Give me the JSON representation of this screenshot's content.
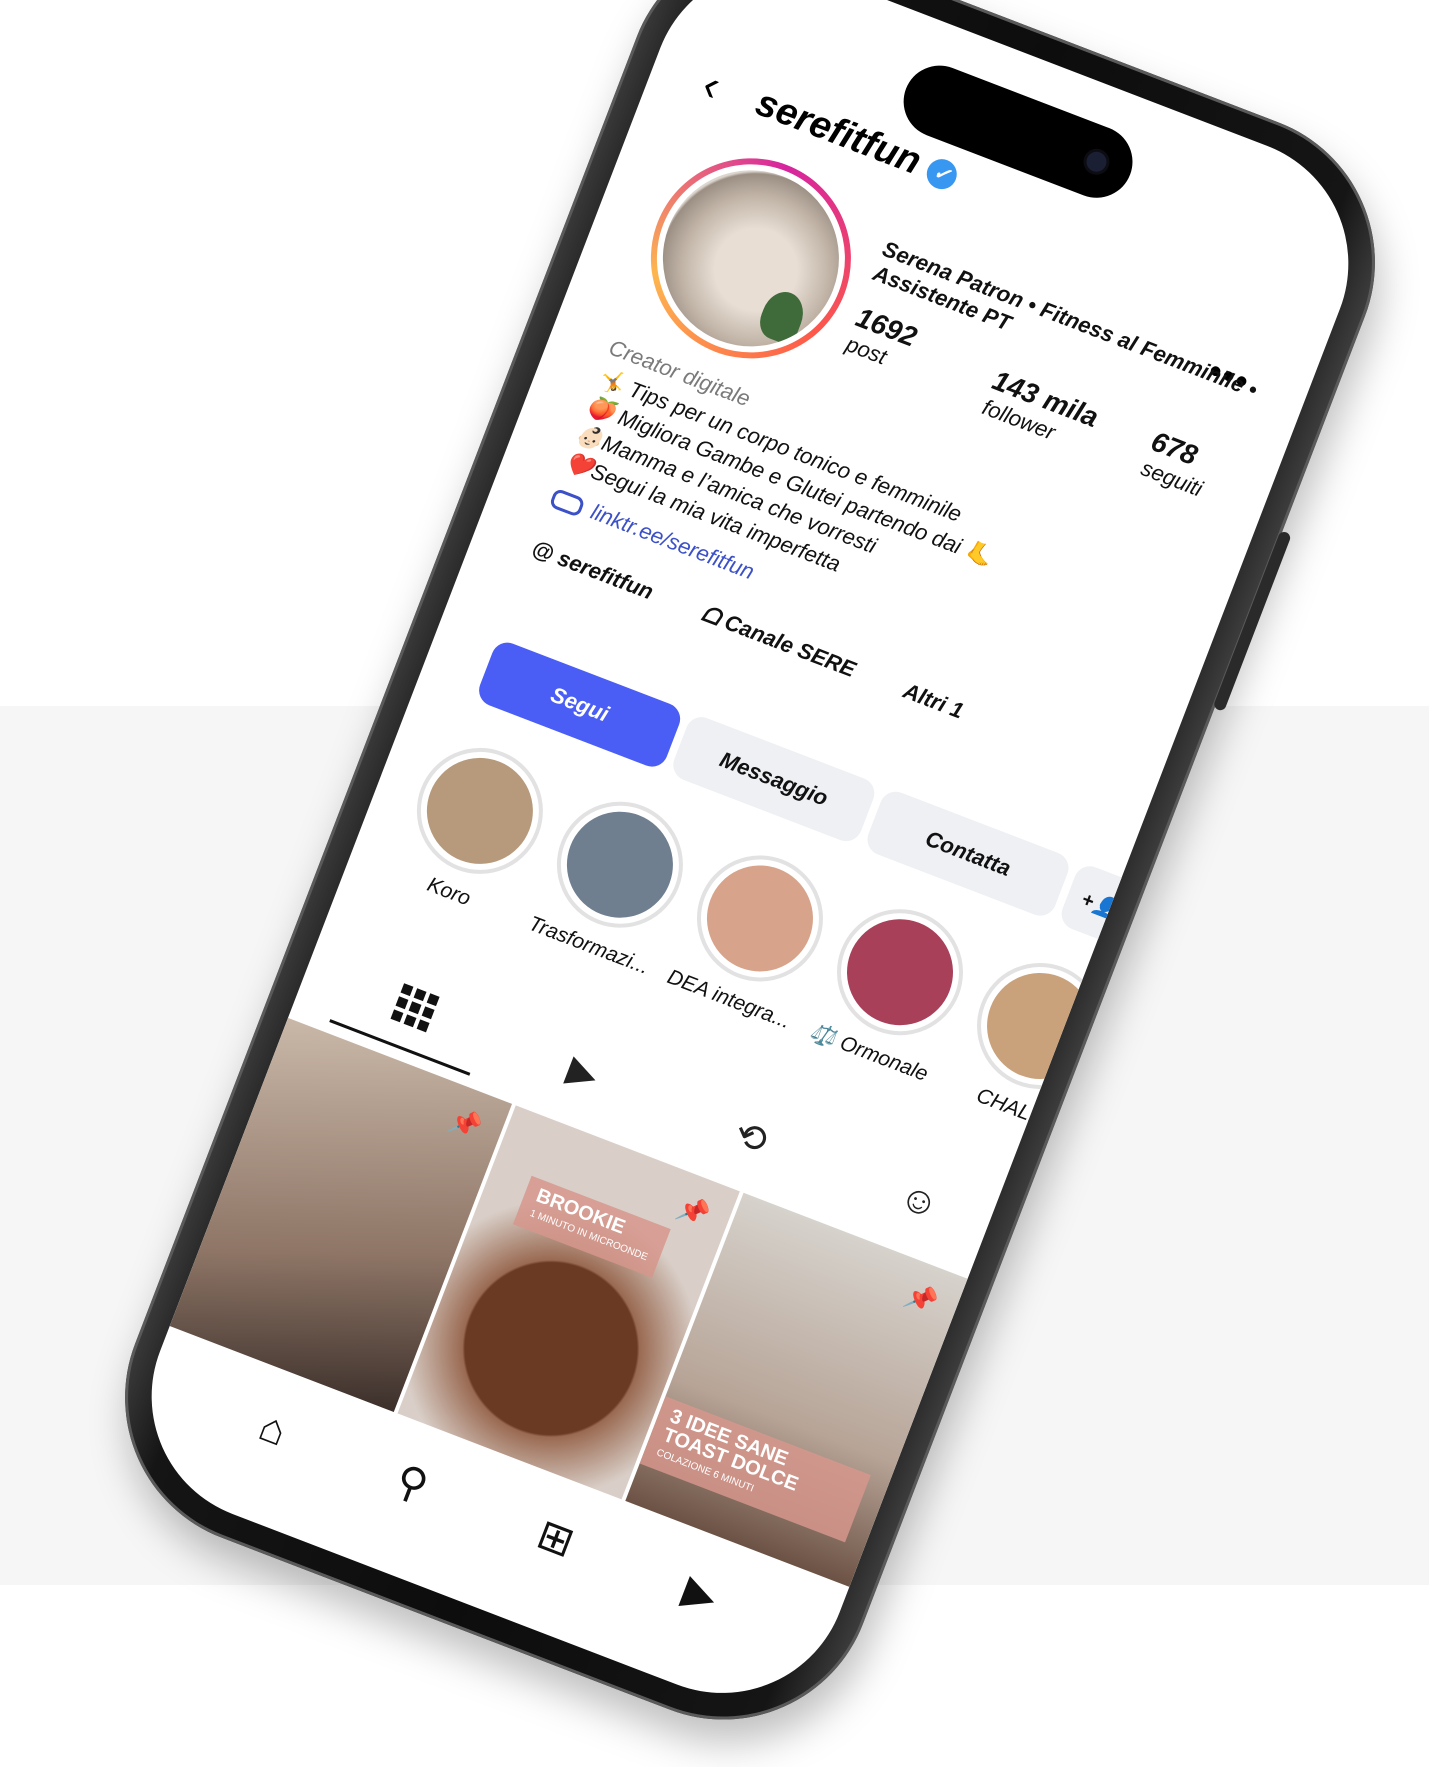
{
  "profile": {
    "username": "serefitfun",
    "full_name": "Serena Patron • Fitness al Femminile • Assistente PT",
    "category": "Creator digitale",
    "bio": [
      "🤸 Tips per un corpo tonico e femminile",
      "🍑 Migliora Gambe e Glutei partendo dai 🦶",
      "👶🏻Mamma e l’amica che vorresti",
      "❤️Segui la mia vita imperfetta"
    ],
    "link": "linktr.ee/serefitfun",
    "chips": [
      "serefitfun",
      "Canale SERE",
      "Altri 1"
    ]
  },
  "stats": [
    {
      "value": "1692",
      "label": "post"
    },
    {
      "value": "143 mila",
      "label": "follower"
    },
    {
      "value": "678",
      "label": "seguiti"
    }
  ],
  "actions": {
    "follow": "Segui",
    "message": "Messaggio",
    "contact": "Contatta",
    "add_user": "+👤"
  },
  "highlights": [
    {
      "label": "Koro",
      "color": "#b79a7c"
    },
    {
      "label": "Trasformazi...",
      "color": "#6f7f8f"
    },
    {
      "label": "DEA integra...",
      "color": "#d7a38a"
    },
    {
      "label": "⚖️ Ormonale",
      "color": "#a8405a"
    },
    {
      "label": "CHALL",
      "color": "#c9a27c"
    }
  ],
  "tiles": [
    {
      "color": "#9c8778",
      "caption": "",
      "sub": ""
    },
    {
      "color": "#7b4c34",
      "caption": "BROOKIE",
      "sub": "1 MINUTO IN MICROONDE"
    },
    {
      "color": "#b8aba0",
      "caption": "3 IDEE SANE TOAST DOLCE",
      "sub": "COLAZIONE 6 MINUTI"
    }
  ],
  "icons": {
    "back": "chevron-left-icon",
    "verified": "verified-badge-icon",
    "more": "more-icon",
    "link": "link-icon",
    "grid": "grid-icon",
    "reels": "reels-icon",
    "reposts": "repost-icon",
    "tagged": "tagged-icon",
    "home": "home-icon",
    "search": "search-icon",
    "create": "create-icon"
  },
  "accent": "#4a5ef5"
}
